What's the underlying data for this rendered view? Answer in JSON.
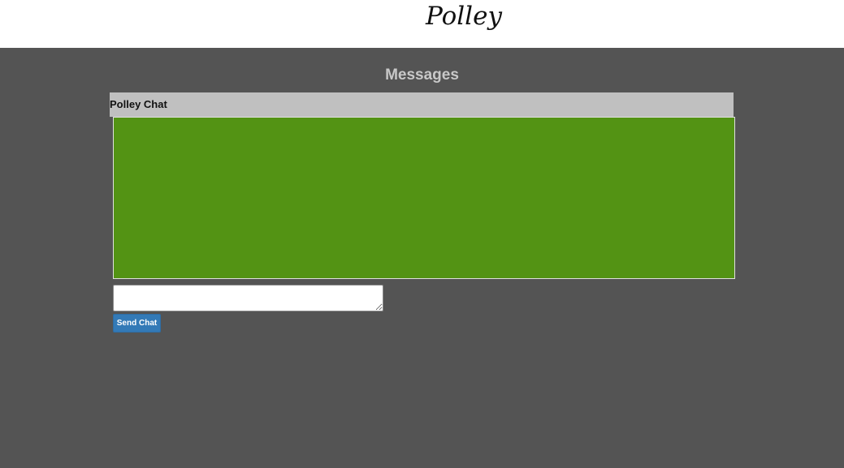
{
  "header": {
    "logo_text": "Polley"
  },
  "main": {
    "title": "Messages",
    "chat": {
      "header_label": "Polley Chat",
      "messages": [],
      "input": {
        "value": "",
        "placeholder": ""
      },
      "send_label": "Send Chat"
    }
  },
  "colors": {
    "page_background": "#545454",
    "header_background": "#ffffff",
    "chat_log_background": "#539314",
    "chat_header_background": "#c0c0c0",
    "button_background": "#337ab7"
  }
}
